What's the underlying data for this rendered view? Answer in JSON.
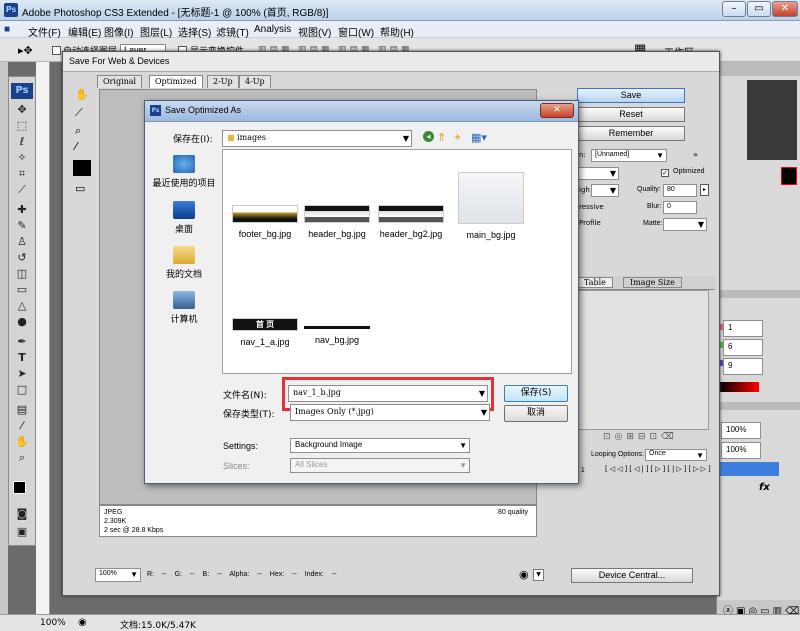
{
  "app": {
    "title": "Adobe Photoshop CS3 Extended - [无标题-1 @ 100% (首页, RGB/8)]"
  },
  "menu": [
    "文件(F)",
    "编辑(E)",
    "图像(I)",
    "图层(L)",
    "选择(S)",
    "滤镜(T)",
    "Analysis",
    "视图(V)",
    "窗口(W)",
    "帮助(H)"
  ],
  "options": {
    "auto_select": "自动选择图层",
    "layer": "Layer",
    "show_transform": "显示变换控件",
    "workspace": "工作区"
  },
  "sfw": {
    "title": "Save For Web & Devices",
    "tabs": [
      "Original",
      "Optimized",
      "2-Up",
      "4-Up"
    ],
    "save": "Save",
    "reset": "Reset",
    "remember": "Remember",
    "preset": "[Unnamed]",
    "optimized": "Optimized",
    "quality_label": "Quality:",
    "quality": "80",
    "blur_label": "Blur:",
    "blur": "0",
    "matte_label": "Matte:",
    "high": "igh",
    "progressive": "ressive",
    "profile": "Profile",
    "lbl_n": "n:",
    "table_tab": "Table",
    "image_size_tab": "Image Size",
    "looping_label": "Looping Options:",
    "looping": "Once",
    "frame": "f 1",
    "info_format": "JPEG",
    "info_size": "2.309K",
    "info_time": "2 sec @ 28.8 Kbps",
    "info_quality": "80 quality",
    "zoom": "100%",
    "r": "R:",
    "g": "G:",
    "b": "B:",
    "alpha": "Alpha:",
    "hex": "Hex:",
    "index": "Index:",
    "dash": "--",
    "device_central": "Device Central..."
  },
  "dialog": {
    "title": "Save Optimized As",
    "save_in_label": "保存在(I):",
    "folder": "images",
    "places": [
      "最近使用的项目",
      "桌面",
      "我的文档",
      "计算机"
    ],
    "files": [
      "footer_bg.jpg",
      "header_bg.jpg",
      "header_bg2.jpg",
      "main_bg.jpg",
      "nav_1_a.jpg",
      "nav_bg.jpg"
    ],
    "nav_thumb_text": "首 页",
    "filename_label": "文件名(N):",
    "filename": "nav_1_b.jpg",
    "filetype_label": "保存类型(T):",
    "filetype": "Images Only (*.jpg)",
    "save_btn": "保存(S)",
    "cancel_btn": "取消",
    "settings_label": "Settings:",
    "settings": "Background Image",
    "slices_label": "Slices:",
    "slices": "All Slices"
  },
  "panels": {
    "v1": "1",
    "v2": "6",
    "v3": "9",
    "zoom1": "100%",
    "zoom2": "100%",
    "fx": "fx"
  },
  "status": {
    "zoom": "100%",
    "doc": "文档:15.0K/5.47K"
  }
}
